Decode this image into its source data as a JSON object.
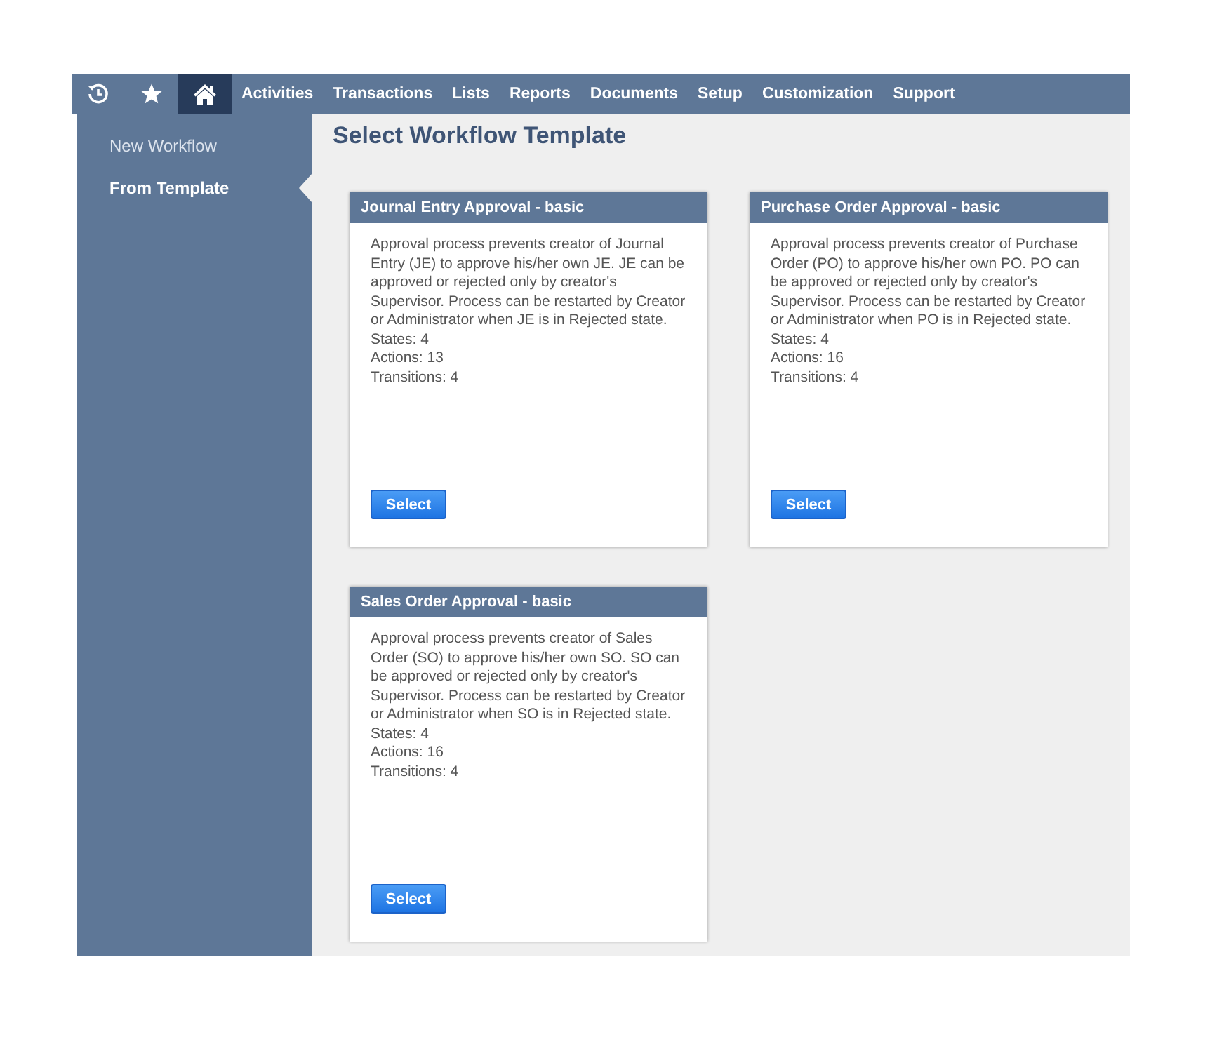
{
  "nav": {
    "icons": [
      {
        "kind": "recent",
        "selected": false
      },
      {
        "kind": "star",
        "selected": false
      },
      {
        "kind": "home",
        "selected": true
      }
    ],
    "menu": [
      "Activities",
      "Transactions",
      "Lists",
      "Reports",
      "Documents",
      "Setup",
      "Customization",
      "Support"
    ]
  },
  "sidebar": {
    "items": [
      {
        "label": "New Workflow",
        "selected": false
      },
      {
        "label": "From Template",
        "selected": true
      }
    ]
  },
  "page_title": "Select Workflow Template",
  "templates": [
    {
      "title": "Journal Entry Approval - basic",
      "description": "Approval process prevents creator of Journal Entry (JE) to approve his/her own JE. JE can be approved or rejected only by creator's Supervisor. Process can be restarted by Creator or Administrator when JE is in Rejected state.",
      "stats": [
        "States: 4",
        "Actions: 13",
        "Transitions: 4"
      ],
      "button": "Select"
    },
    {
      "title": "Purchase Order Approval - basic",
      "description": "Approval process prevents creator of Purchase Order (PO) to approve his/her own PO. PO can be approved or rejected only by creator's Supervisor. Process can be restarted by Creator or Administrator when PO is in Rejected state.",
      "stats": [
        "States: 4",
        "Actions: 16",
        "Transitions: 4"
      ],
      "button": "Select"
    },
    {
      "title": "Sales Order Approval - basic",
      "description": "Approval process prevents creator of Sales Order (SO) to approve his/her own SO. SO can be approved or rejected only by creator's Supervisor. Process can be restarted by Creator or Administrator when SO is in Rejected state.",
      "stats": [
        "States: 4",
        "Actions: 16",
        "Transitions: 4"
      ],
      "button": "Select"
    }
  ]
}
